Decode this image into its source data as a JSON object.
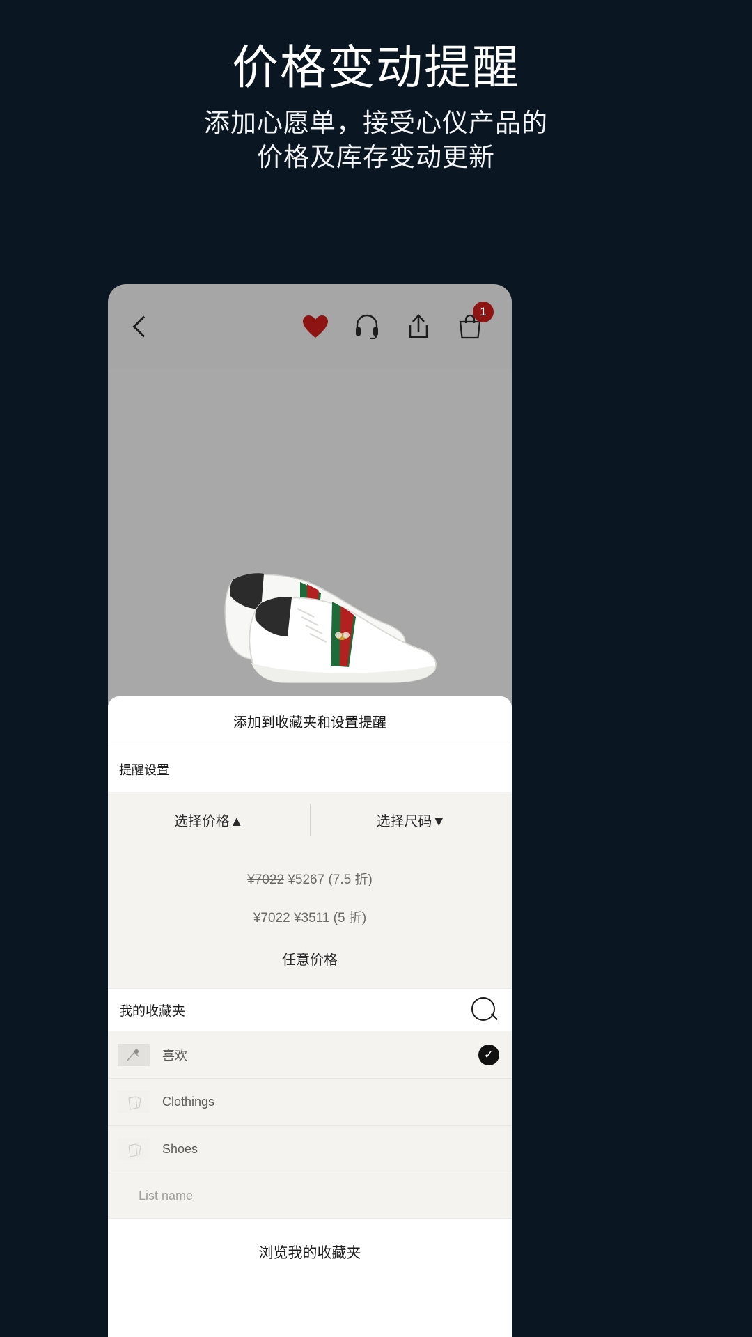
{
  "promo": {
    "title": "价格变动提醒",
    "subtitle_line1": "添加心愿单，接受心仪产品的",
    "subtitle_line2": "价格及库存变动更新",
    "background_color": "#0a1722",
    "text_color": "#ffffff"
  },
  "toolbar": {
    "back_icon": "chevron-left-icon",
    "wishlist_icon": "heart-filled-icon",
    "wishlist_color": "#8e1414",
    "support_icon": "headset-icon",
    "share_icon": "share-icon",
    "bag_icon": "shopping-bag-icon",
    "bag_badge_count": "1",
    "bag_badge_color": "#8e1414"
  },
  "product": {
    "name": "white-sneaker",
    "stripe_colors": [
      "#1e6b3a",
      "#b32020"
    ]
  },
  "sheet": {
    "title": "添加到收藏夹和设置提醒",
    "section_label": "提醒设置",
    "tabs": [
      {
        "label": "选择价格",
        "caret": "▲",
        "state": "expanded"
      },
      {
        "label": "选择尺码",
        "caret": "▼",
        "state": "collapsed"
      }
    ],
    "price_options": [
      {
        "original": "¥7022",
        "discounted": "¥5267",
        "note": "(7.5 折)"
      },
      {
        "original": "¥7022",
        "discounted": "¥3511",
        "note": "(5 折)"
      }
    ],
    "any_price_label": "任意价格",
    "favorites": {
      "header": "我的收藏夹",
      "search_icon": "search-icon",
      "items": [
        {
          "label": "喜欢",
          "selected": true,
          "check_icon": "check-circle-icon"
        },
        {
          "label": "Clothings",
          "selected": false
        },
        {
          "label": "Shoes",
          "selected": false
        }
      ],
      "list_name_placeholder": "List name"
    },
    "browse_button": "浏览我的收藏夹"
  }
}
